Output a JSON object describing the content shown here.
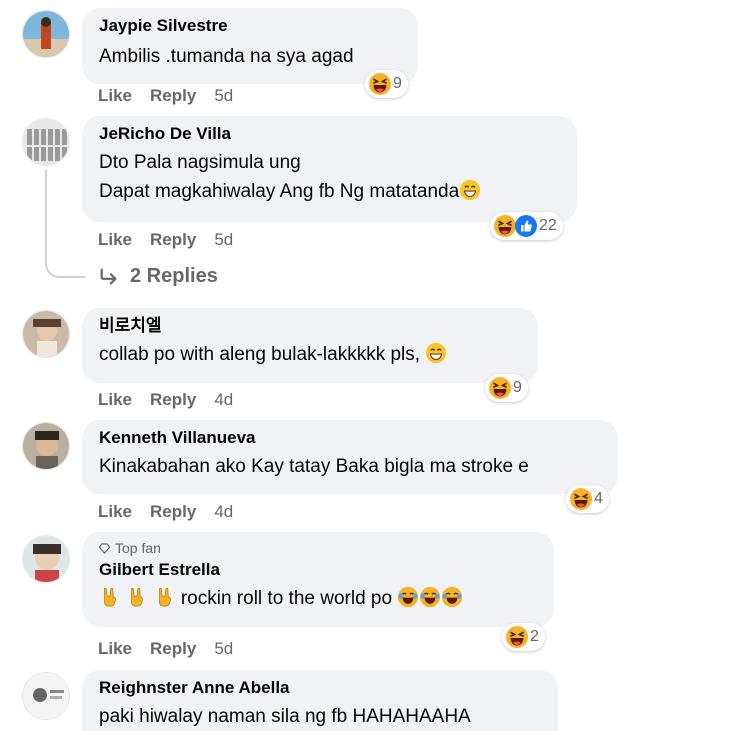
{
  "actions": {
    "like": "Like",
    "reply": "Reply"
  },
  "comments": [
    {
      "author": "Jaypie Silvestre",
      "lines": [
        "Ambilis .tumanda na sya agad"
      ],
      "time": "5d",
      "reactions": {
        "icons": [
          "haha-icon"
        ],
        "count": "9"
      }
    },
    {
      "author": "JeRicho De Villa",
      "lines": [
        "Dto Pala nagsimula ung",
        "Dapat magkahiwalay Ang fb Ng matatanda"
      ],
      "time": "5d",
      "reactions": {
        "icons": [
          "haha-icon",
          "like-icon"
        ],
        "count": "22"
      },
      "replies_label": "2 Replies"
    },
    {
      "author": "비로치엘",
      "lines": [
        "collab po with aleng bulak-lakkkkk pls,"
      ],
      "time": "4d",
      "reactions": {
        "icons": [
          "haha-icon"
        ],
        "count": "9"
      }
    },
    {
      "author": "Kenneth Villanueva",
      "lines": [
        "Kinakabahan ako Kay tatay Baka bigla ma stroke e"
      ],
      "time": "4d",
      "reactions": {
        "icons": [
          "haha-icon"
        ],
        "count": "4"
      }
    },
    {
      "badge": "Top fan",
      "author": "Gilbert Estrella",
      "lines": [
        "rockin roll to the world po"
      ],
      "time": "5d",
      "reactions": {
        "icons": [
          "haha-icon"
        ],
        "count": "2"
      }
    },
    {
      "author": "Reighnster Anne Abella",
      "lines": [
        "paki hiwalay naman sila ng fb HAHAHAAHA"
      ]
    }
  ],
  "colors": {
    "bubble": "#f0f2f5",
    "meta": "#65676b",
    "text": "#050505",
    "haha_yellow": "#f7b125",
    "like_blue": "#1877f2"
  }
}
